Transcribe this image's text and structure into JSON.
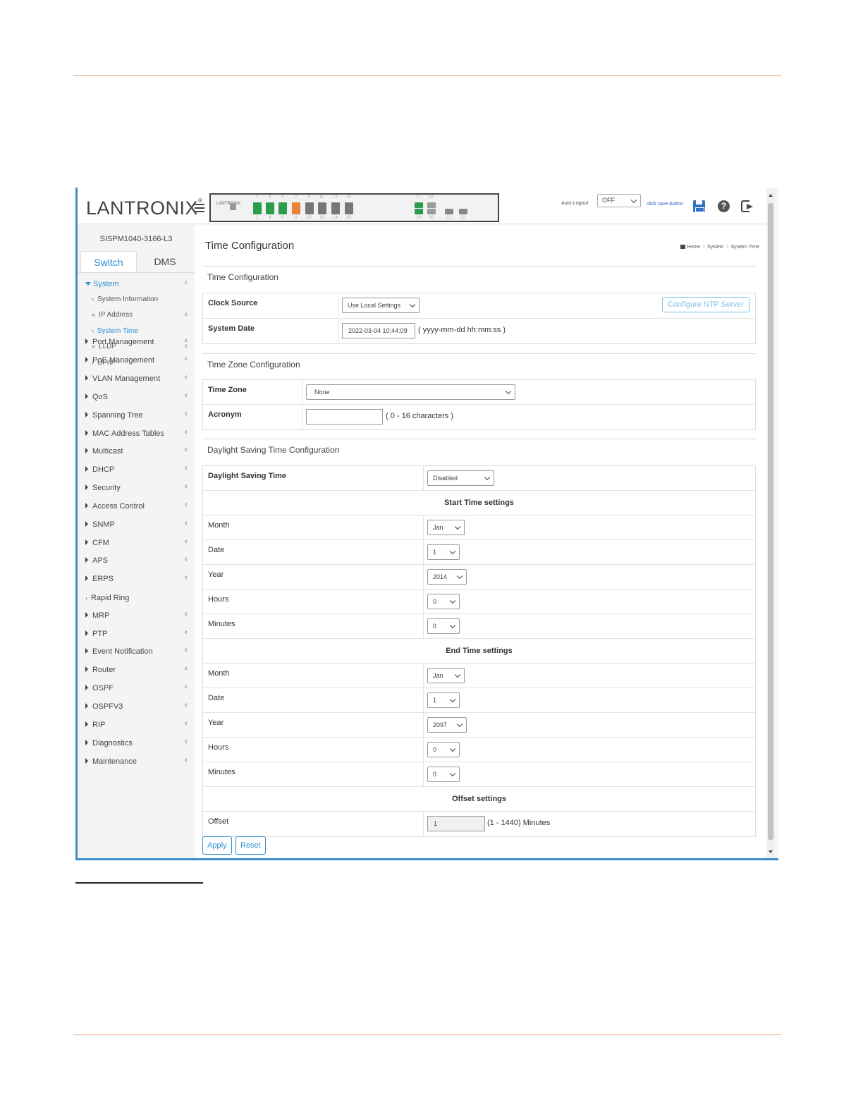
{
  "header": {
    "brand": "LANTRONIX",
    "brand_mark": "®",
    "device_mini_logo": "LANTRONIX",
    "autologout_label": "Auto-Logout",
    "autologout_value": "OFF",
    "save_hint": "click save button",
    "help_glyph": "?",
    "port_top_numbers": [
      "1",
      "3",
      "5",
      "7",
      "9",
      "11",
      "13",
      "15",
      "17",
      "18"
    ],
    "port_bottom_numbers": [
      "2",
      "4",
      "6",
      "8",
      "10",
      "12",
      "14",
      "16",
      "19",
      "20",
      "21",
      "22"
    ]
  },
  "sidebar": {
    "model": "SISPM1040-3166-L3",
    "tabs": [
      "Switch",
      "DMS"
    ],
    "system": "System",
    "sub_items": [
      "System Information",
      "IP Address",
      "System Time",
      "LLDP",
      "UPnP"
    ],
    "items": [
      "Port Management",
      "PoE Management",
      "VLAN Management",
      "QoS",
      "Spanning Tree",
      "MAC Address Tables",
      "Multicast",
      "DHCP",
      "Security",
      "Access Control",
      "SNMP",
      "CFM",
      "APS",
      "ERPS",
      "Rapid Ring",
      "MRP",
      "PTP",
      "Event Notification",
      "Router",
      "OSPF",
      "OSPFV3",
      "RIP",
      "Diagnostics",
      "Maintenance"
    ],
    "arrow_glyph": "‹"
  },
  "main": {
    "page_title": "Time Configuration",
    "breadcrumb": [
      "Home",
      "System",
      "System Time"
    ],
    "breadcrumb_sep": ">",
    "time_config": {
      "title": "Time Configuration",
      "clock_source_label": "Clock Source",
      "clock_source_value": "Use Local Settings",
      "ntp_button": "Configure NTP Server",
      "system_date_label": "System Date",
      "system_date_value": "2022-03-04 10:44:09",
      "system_date_hint": "( yyyy-mm-dd hh:mm:ss )"
    },
    "tz_config": {
      "title": "Time Zone Configuration",
      "time_zone_label": "Time Zone",
      "time_zone_value": "None",
      "acronym_label": "Acronym",
      "acronym_value": "",
      "acronym_hint": "( 0 - 16 characters )"
    },
    "dst_config": {
      "title": "Daylight Saving Time Configuration",
      "dst_label": "Daylight Saving Time",
      "dst_value": "Disabled",
      "start_title": "Start Time settings",
      "start": {
        "month_label": "Month",
        "month_value": "Jan",
        "date_label": "Date",
        "date_value": "1",
        "year_label": "Year",
        "year_value": "2014",
        "hours_label": "Hours",
        "hours_value": "0",
        "minutes_label": "Minutes",
        "minutes_value": "0"
      },
      "end_title": "End Time settings",
      "end": {
        "month_label": "Month",
        "month_value": "Jan",
        "date_label": "Date",
        "date_value": "1",
        "year_label": "Year",
        "year_value": "2097",
        "hours_label": "Hours",
        "hours_value": "0",
        "minutes_label": "Minutes",
        "minutes_value": "0"
      },
      "offset_title": "Offset settings",
      "offset_label": "Offset",
      "offset_value": "1",
      "offset_hint": "(1 - 1440) Minutes"
    },
    "apply_label": "Apply",
    "reset_label": "Reset"
  },
  "colors": {
    "accent": "#2d8fd5",
    "port_green": "#2a9d4b",
    "port_orange": "#e8833a",
    "page_rule": "#e8a070"
  }
}
